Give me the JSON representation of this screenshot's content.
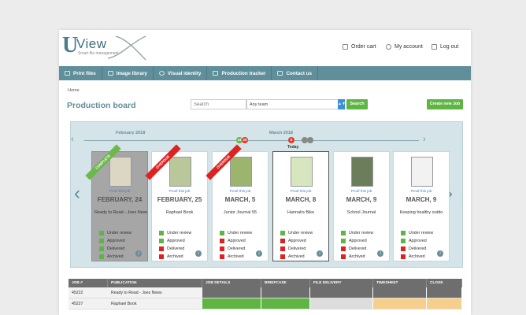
{
  "header": {
    "logo": {
      "u": "U",
      "view": "View",
      "sub": "Smart file management"
    },
    "links": [
      {
        "label": "Order cart",
        "icon": "cart-icon"
      },
      {
        "label": "My account",
        "icon": "user-icon"
      },
      {
        "label": "Log out",
        "icon": "logout-icon"
      }
    ]
  },
  "nav": [
    {
      "label": "Print files",
      "icon": "print-icon"
    },
    {
      "label": "Image library",
      "icon": "image-icon"
    },
    {
      "label": "Visual identity",
      "icon": "eye-icon"
    },
    {
      "label": "Production tracker",
      "icon": "shuffle-icon"
    },
    {
      "label": "Contact us",
      "icon": "phone-icon"
    }
  ],
  "breadcrumb": "Home",
  "page_title": "Production board",
  "search": {
    "placeholder": "Search",
    "team_value": "Any team",
    "button": "Search"
  },
  "create_button": "Create new Job",
  "timeline": {
    "months": [
      "February 2018",
      "March 2018"
    ],
    "today_label": "Today",
    "markers": [
      {
        "label": "24",
        "color": "#5fb544"
      },
      {
        "label": "25",
        "color": "#e23b2e"
      },
      {
        "label": "8",
        "color": "#e23b2e"
      },
      {
        "label": "",
        "color": "#888888"
      },
      {
        "label": "",
        "color": "#888888"
      }
    ]
  },
  "status_labels": [
    "Under review",
    "Approved",
    "Delivered",
    "Archived"
  ],
  "colors": {
    "green": "#5fb544",
    "red": "#dd2222",
    "teal": "#5f8f9a",
    "done_ribbon": "#6cb84b",
    "overdue_ribbon": "#dd2222"
  },
  "cards": [
    {
      "date": "FEBRUARY, 24",
      "name": "Ready to Read - Joes News",
      "proof": "Proof this job",
      "ribbon": "COMPLETE",
      "style": "done",
      "statuses": [
        "green",
        "green",
        "green",
        "green"
      ]
    },
    {
      "date": "FEBRUARY, 25",
      "name": "Raphael Book",
      "proof": "Proof this job",
      "ribbon": "OVERDUE",
      "style": "normal",
      "statuses": [
        "green",
        "green",
        "red",
        "red"
      ]
    },
    {
      "date": "MARCH, 5",
      "name": "Junior Journal 55",
      "proof": "Proof this job",
      "ribbon": "OVERDUE",
      "style": "normal",
      "statuses": [
        "green",
        "red",
        "red",
        "red"
      ]
    },
    {
      "date": "MARCH, 8",
      "name": "Hannahs Bike",
      "proof": "Proof this job",
      "ribbon": "",
      "style": "sel",
      "statuses": [
        "green",
        "red",
        "red",
        "red"
      ]
    },
    {
      "date": "MARCH, 9",
      "name": "School Journal",
      "proof": "Proof this job",
      "ribbon": "",
      "style": "normal",
      "statuses": [
        "green",
        "green",
        "red",
        "red"
      ]
    },
    {
      "date": "MARCH, 9",
      "name": "Keeping healthy outdo",
      "proof": "Proof this job",
      "ribbon": "",
      "style": "normal",
      "statuses": [
        "green",
        "green",
        "red",
        "red"
      ]
    }
  ],
  "table": {
    "headers": [
      "JOB #",
      "PUBLICATION",
      "JOB DETAILS",
      "BRIEFCASE",
      "FILE DELIVERY",
      "TIMESHEET",
      "CLOSE"
    ],
    "rows": [
      {
        "job": "45222",
        "publication": "Ready to Read - Joes News",
        "cells": [
          "#6e6e6e",
          "#6e6e6e",
          "#6e6e6e",
          "#6e6e6e",
          "#6e6e6e"
        ]
      },
      {
        "job": "45227",
        "publication": "Raphael Book",
        "cells": [
          "#5fb544",
          "#5fb544",
          "#dddddd",
          "#f7cf8c",
          "#f7cf8c"
        ]
      }
    ]
  }
}
